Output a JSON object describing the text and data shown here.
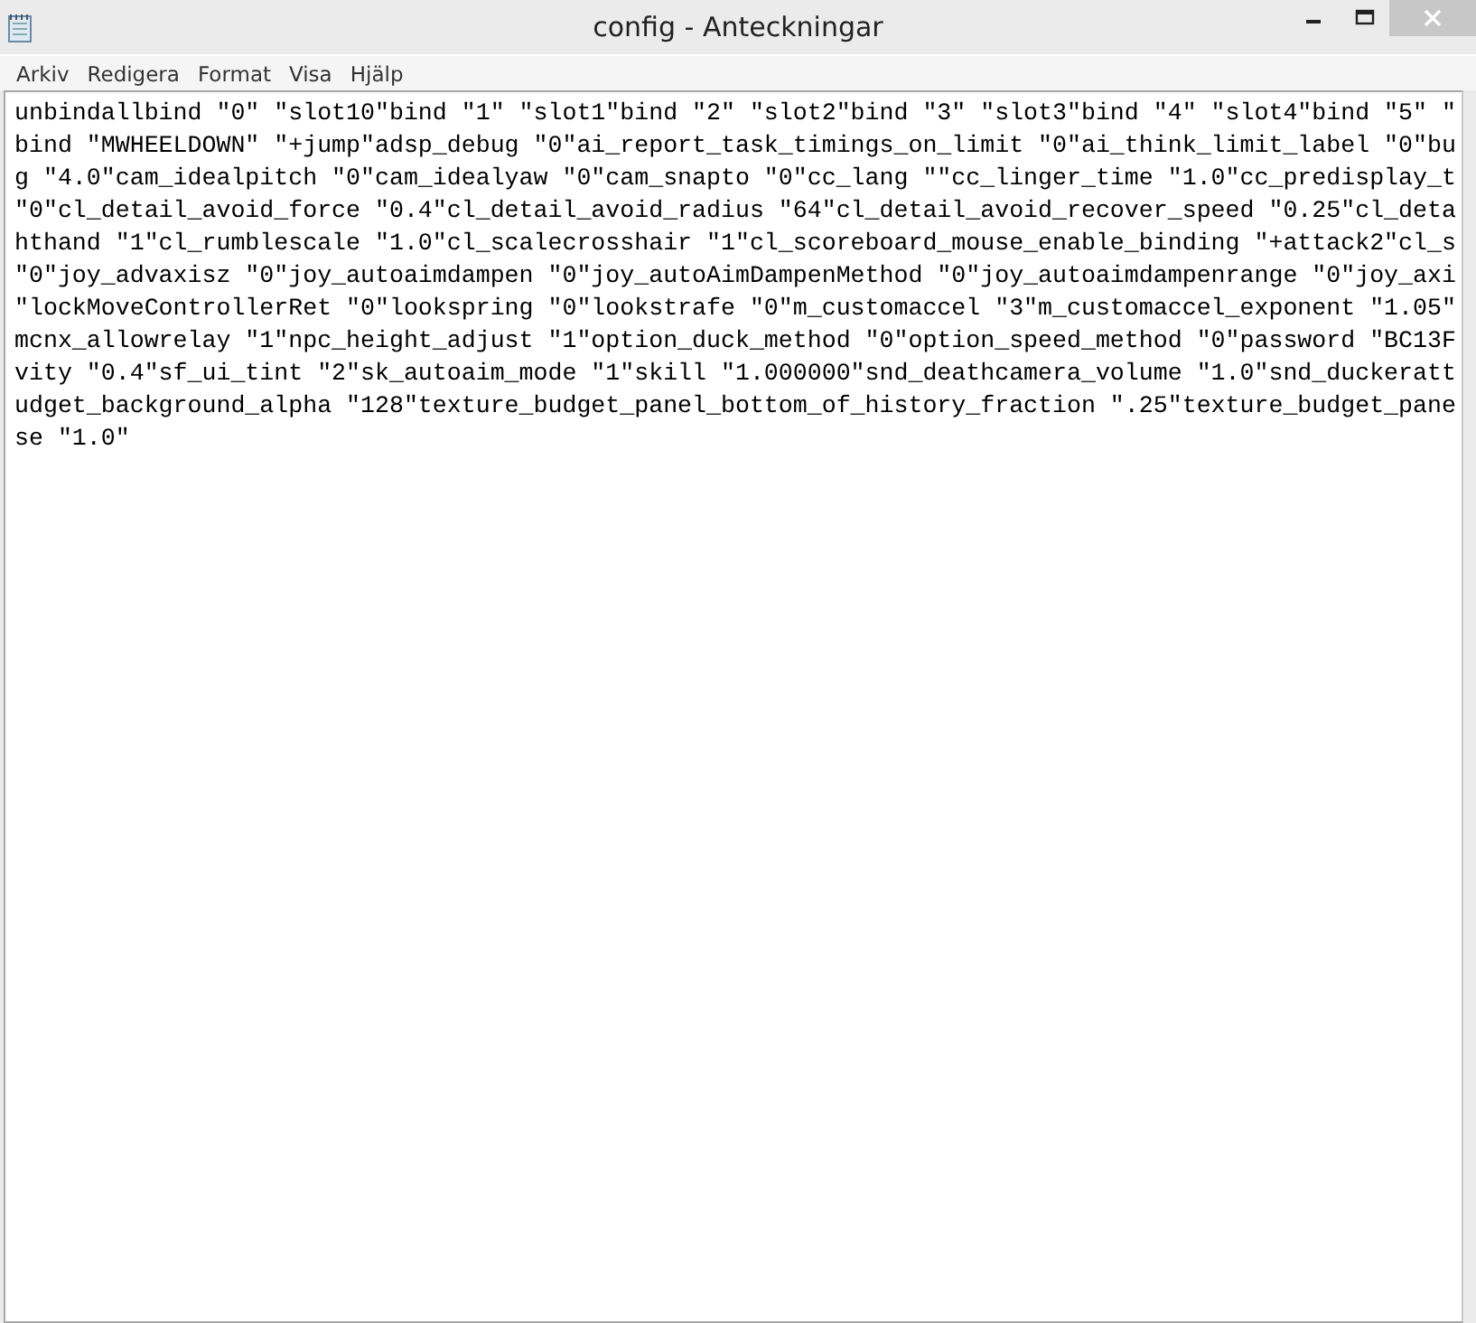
{
  "window": {
    "title": "config - Anteckningar"
  },
  "menu": [
    "Arkiv",
    "Redigera",
    "Format",
    "Visa",
    "Hjälp"
  ],
  "editor": {
    "lines": [
      "unbindallbind \"0\" \"slot10\"bind \"1\" \"slot1\"bind \"2\" \"slot2\"bind \"3\" \"slot3\"bind \"4\" \"slot4\"bind \"5\" \"",
      "bind \"MWHEELDOWN\" \"+jump\"adsp_debug \"0\"ai_report_task_timings_on_limit \"0\"ai_think_limit_label \"0\"bu",
      "g \"4.0\"cam_idealpitch \"0\"cam_idealyaw \"0\"cam_snapto \"0\"cc_lang \"\"cc_linger_time \"1.0\"cc_predisplay_t",
      "\"0\"cl_detail_avoid_force \"0.4\"cl_detail_avoid_radius \"64\"cl_detail_avoid_recover_speed \"0.25\"cl_deta",
      "hthand \"1\"cl_rumblescale \"1.0\"cl_scalecrosshair \"1\"cl_scoreboard_mouse_enable_binding \"+attack2\"cl_s",
      "\"0\"joy_advaxisz \"0\"joy_autoaimdampen \"0\"joy_autoAimDampenMethod \"0\"joy_autoaimdampenrange \"0\"joy_axi",
      "\"lockMoveControllerRet \"0\"lookspring \"0\"lookstrafe \"0\"m_customaccel \"3\"m_customaccel_exponent \"1.05\"",
      "mcnx_allowrelay \"1\"npc_height_adjust \"1\"option_duck_method \"0\"option_speed_method \"0\"password \"BC13F",
      "vity \"0.4\"sf_ui_tint \"2\"sk_autoaim_mode \"1\"skill \"1.000000\"snd_deathcamera_volume \"1.0\"snd_duckeratt",
      "udget_background_alpha \"128\"texture_budget_panel_bottom_of_history_fraction \".25\"texture_budget_pane",
      "se \"1.0\""
    ]
  }
}
